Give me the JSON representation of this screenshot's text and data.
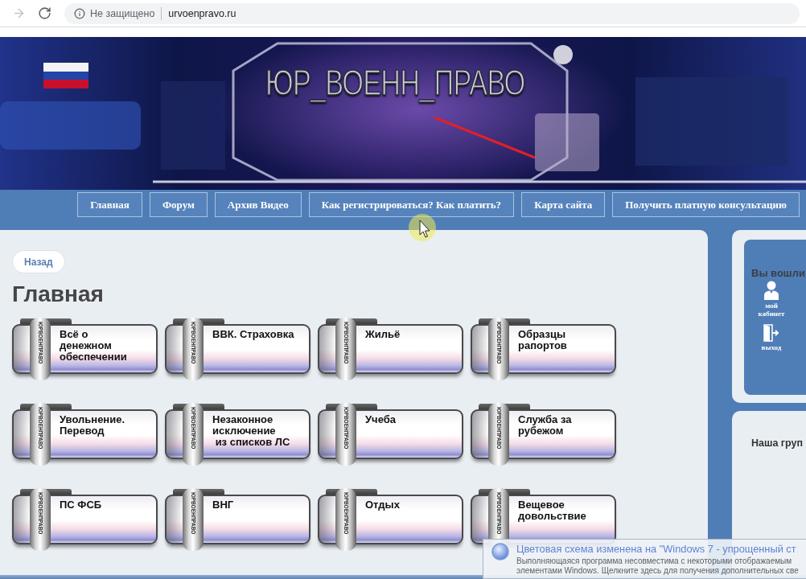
{
  "browser": {
    "nav_buttons": [
      {
        "kind": "forward",
        "disabled": true
      },
      {
        "kind": "reload",
        "disabled": false
      }
    ],
    "security_label": "Не защищено",
    "url": "urvoenpravo.ru"
  },
  "banner": {
    "logo": "ЮР_ВОЕНН_ПРАВО"
  },
  "nav": [
    {
      "label": "Главная"
    },
    {
      "label": "Форум"
    },
    {
      "label": "Архив Видео"
    },
    {
      "label": "Как регистрироваться? Как платить?"
    },
    {
      "label": "Карта сайта"
    },
    {
      "label": "Получить платную консультацию"
    }
  ],
  "main": {
    "back_button": "Назад",
    "heading": "Главная",
    "cards": [
      {
        "label": "Всё о\nденежном\nобеспечении",
        "strip": "ЮРВОЕНПРАВО"
      },
      {
        "label": "ВВК. Страховка",
        "strip": "ЮРВОЕНПРАВО"
      },
      {
        "label": "Жильё",
        "strip": "ЮРВОЕНПРАВО"
      },
      {
        "label": "Образцы\nрапортов",
        "strip": "ЮРВОЕНПРАВО"
      },
      {
        "label": "Увольнение.\nПеревод",
        "strip": "ЮРВОЕНПРАВО"
      },
      {
        "label": "Незаконное\nисключение\n из списков ЛС",
        "strip": "ЮРВОЕНПРАВО"
      },
      {
        "label": "Учеба",
        "strip": "ЮРВОЕНПРАВО"
      },
      {
        "label": "Служба за\nрубежом",
        "strip": "ЮРВОЕНПРАВО"
      },
      {
        "label": "ПС ФСБ",
        "strip": "ЮРВОЕНПРАВО"
      },
      {
        "label": "ВНГ",
        "strip": "ЮРВОЕНПРАВО"
      },
      {
        "label": "Отдых",
        "strip": "ЮРВОЕНПРАВО"
      },
      {
        "label": "Вещевое\nдовольствие",
        "strip": "ЮРВОЕНПРАВО"
      }
    ]
  },
  "sidebar": {
    "login_title": "Вы вошли",
    "links": [
      {
        "kind": "cabinet",
        "label": "мой кабинет"
      },
      {
        "kind": "exit",
        "label": "выход"
      }
    ],
    "group_title": "Наша груп"
  },
  "notification": {
    "title": "Цветовая схема изменена на \"Windows 7 - упрощенный ст",
    "body": "Выполняющаяся программа несовместима с некоторыми отображаемым\nэлементами Windows. Щелкните здесь для получения дополнительных све"
  }
}
